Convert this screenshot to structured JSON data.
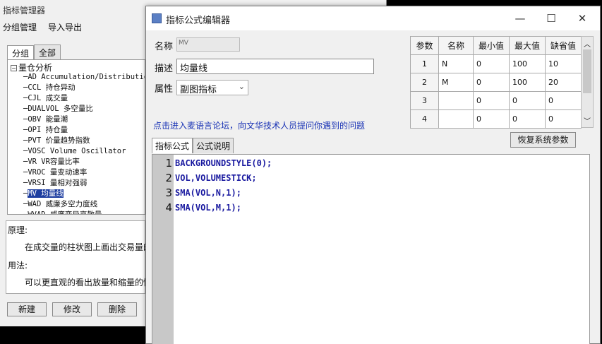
{
  "manager": {
    "title": "指标管理器",
    "menu": [
      "分组管理",
      "导入导出"
    ],
    "tabs": [
      "分组",
      "全部"
    ],
    "tree_root": "量仓分析",
    "tree_items": [
      "AD Accumulation/Distribution",
      "CCL 持仓异动",
      "CJL 成交量",
      "DUALVOL 多空量比",
      "OBV 能量潮",
      "OPI 持仓量",
      "PVT 价量趋势指数",
      "VOSC Volume Oscillator",
      "VR VR容量比率",
      "VROC 量变动速率",
      "VRSI 量相对强弱",
      "MV 均量线",
      "WAD 威廉多空力度线",
      "WVAD 威廉变异离散量"
    ],
    "selected_index": 11,
    "desc": {
      "principle_label": "原理:",
      "principle_text": "在成交量的柱状图上画出交易量的",
      "usage_label": "用法:",
      "usage_text": "可以更直观的看出放量和缩量的情"
    },
    "buttons": [
      "新建",
      "修改",
      "删除"
    ]
  },
  "editor": {
    "title": "指标公式编辑器",
    "controls": {
      "minimize": "—",
      "maximize": "☐",
      "close": "✕"
    },
    "name_label": "名称",
    "name_value": "MV",
    "desc_label": "描述",
    "desc_value": "均量线",
    "attr_label": "属性",
    "attr_value": "副图指标",
    "forum_link": "点击进入麦语言论坛，向文华技术人员提问你遇到的问题",
    "params": {
      "headers": [
        "参数",
        "名称",
        "最小值",
        "最大值",
        "缺省值"
      ],
      "rows": [
        [
          "1",
          "N",
          "0",
          "100",
          "10"
        ],
        [
          "2",
          "M",
          "0",
          "100",
          "20"
        ],
        [
          "3",
          "",
          "0",
          "0",
          "0"
        ],
        [
          "4",
          "",
          "0",
          "0",
          "0"
        ]
      ]
    },
    "restore_button": "恢复系统参数",
    "tabs": [
      "指标公式",
      "公式说明"
    ],
    "code_lines": [
      {
        "num": "1",
        "code": "BACKGROUNDSTYLE(0);"
      },
      {
        "num": "2",
        "code": "VOL,VOLUMESTICK;"
      },
      {
        "num": "3",
        "code": "SMA(VOL,N,1);"
      },
      {
        "num": "4",
        "code": "SMA(VOL,M,1);"
      }
    ]
  }
}
